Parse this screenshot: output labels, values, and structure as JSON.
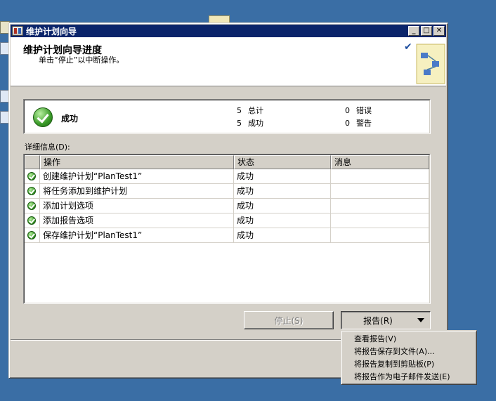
{
  "window": {
    "title": "维护计划向导"
  },
  "header": {
    "title": "维护计划向导进度",
    "subtitle": "单击“停止”以中断操作。"
  },
  "summary": {
    "status": "成功",
    "total_count": "5",
    "total_label": "总计",
    "success_count": "5",
    "success_label": "成功",
    "error_count": "0",
    "error_label": "错误",
    "warning_count": "0",
    "warning_label": "警告"
  },
  "details": {
    "label": "详细信息(D):",
    "columns": [
      "操作",
      "状态",
      "消息"
    ],
    "rows": [
      {
        "action": "创建维护计划“PlanTest1”",
        "status": "成功",
        "message": ""
      },
      {
        "action": "将任务添加到维护计划",
        "status": "成功",
        "message": ""
      },
      {
        "action": "添加计划选项",
        "status": "成功",
        "message": ""
      },
      {
        "action": "添加报告选项",
        "status": "成功",
        "message": ""
      },
      {
        "action": "保存维护计划“PlanTest1”",
        "status": "成功",
        "message": ""
      }
    ]
  },
  "buttons": {
    "stop": "停止(S)",
    "report": "报告(R)"
  },
  "report_menu": {
    "items": [
      "查看报告(V)",
      "将报告保存到文件(A)...",
      "将报告复制到剪贴板(P)",
      "将报告作为电子邮件发送(E)"
    ]
  },
  "colors": {
    "desktop": "#3a6ea5",
    "titlebar": "#0a246a",
    "dialog": "#d4d0c8",
    "success_green": "#3a9a28"
  },
  "icons": {
    "success": "success-check-icon",
    "header_graphic": "wizard-graphic-icon"
  }
}
